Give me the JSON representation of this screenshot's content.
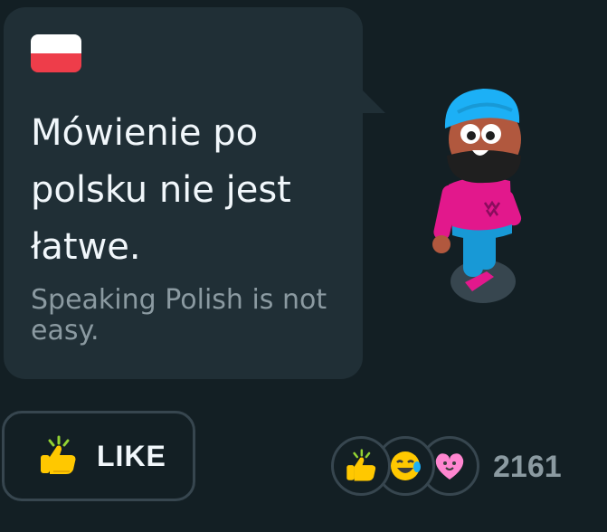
{
  "message": {
    "flag": "poland-flag-icon",
    "text": "Mówienie po polsku nie jest łatwe.",
    "translation": "Speaking Polish is not easy."
  },
  "like_button": {
    "icon": "thumbs-up-icon",
    "label": "LIKE"
  },
  "reactions": {
    "icons": [
      "thumbs-up-icon",
      "laughing-face-icon",
      "heart-face-icon"
    ],
    "count": "2161"
  },
  "colors": {
    "background": "#131f24",
    "bubble": "#202f36",
    "border": "#37464f",
    "text": "#f1f7fb",
    "muted_text": "#8b9aa1",
    "flag_red": "#ee3d4a",
    "thumb_yellow": "#ffc800"
  }
}
